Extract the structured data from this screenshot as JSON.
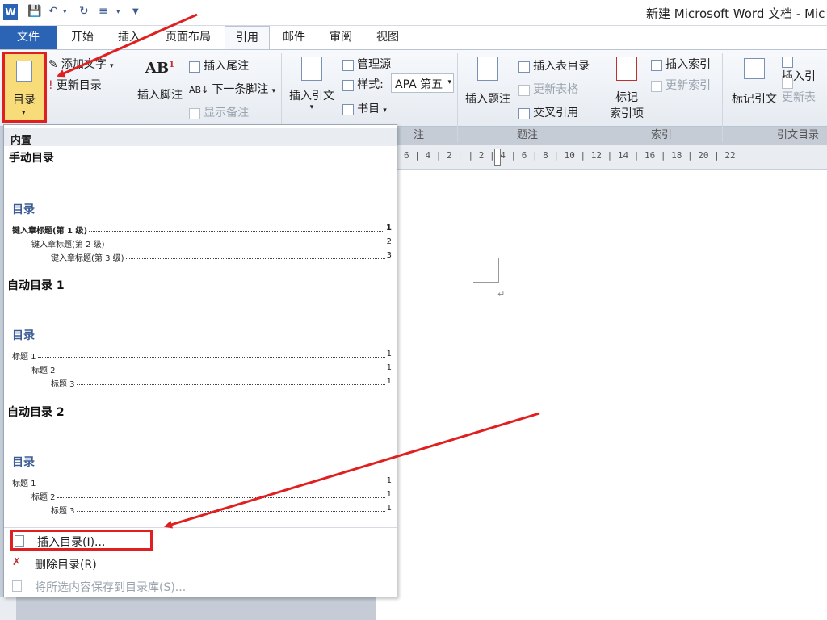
{
  "window": {
    "title": "新建 Microsoft Word 文档 - Mic"
  },
  "quick_access": {
    "icons": [
      "word-icon",
      "save-icon",
      "undo-icon",
      "redo-icon",
      "list-icon",
      "customize-icon"
    ]
  },
  "tabs": [
    {
      "label": "文件"
    },
    {
      "label": "开始"
    },
    {
      "label": "插入"
    },
    {
      "label": "页面布局"
    },
    {
      "label": "引用"
    },
    {
      "label": "邮件"
    },
    {
      "label": "审阅"
    },
    {
      "label": "视图"
    }
  ],
  "ribbon": {
    "toc": {
      "label": "目录",
      "add_text": "添加文字",
      "update_toc": "更新目录"
    },
    "footnote": {
      "insert_footnote": "插入脚注",
      "insert_endnote": "插入尾注",
      "next_footnote": "下一条脚注",
      "show_notes": "显示备注",
      "group_tail": "注"
    },
    "citation": {
      "insert_citation": "插入引文",
      "manage_sources": "管理源",
      "style_label": "样式:",
      "style_value": "APA 第五",
      "bibliography": "书目"
    },
    "caption": {
      "insert_caption": "插入题注",
      "insert_table_of_figures": "插入表目录",
      "update_table": "更新表格",
      "cross_reference": "交叉引用",
      "group": "题注"
    },
    "index": {
      "mark_entry_l1": "标记",
      "mark_entry_l2": "索引项",
      "insert_index": "插入索引",
      "update_index": "更新索引",
      "group": "索引"
    },
    "toa": {
      "mark_citation": "标记引文",
      "insert_toa": "插入引",
      "update_toa": "更新表",
      "group": "引文目录"
    }
  },
  "ruler": {
    "text": "6 | 4 | 2 |   | 2 | 4 | 6 | 8 | 10 | 12 | 14 | 16 | 18 | 20 | 22"
  },
  "dropdown": {
    "header": "内置",
    "galleries": [
      {
        "name": "手动目录",
        "toc_title": "目录",
        "lines": [
          {
            "text": "键入章标题(第 1 级)",
            "page": "1"
          },
          {
            "text": "键入章标题(第 2 级)",
            "page": "2"
          },
          {
            "text": "键入章标题(第 3 级)",
            "page": "3"
          }
        ]
      },
      {
        "name": "自动目录 1",
        "toc_title": "目录",
        "lines": [
          {
            "text": "标题 1",
            "page": "1"
          },
          {
            "text": "标题 2",
            "page": "1"
          },
          {
            "text": "标题 3",
            "page": "1"
          }
        ]
      },
      {
        "name": "自动目录 2",
        "toc_title": "目录",
        "lines": [
          {
            "text": "标题 1",
            "page": "1"
          },
          {
            "text": "标题 2",
            "page": "1"
          },
          {
            "text": "标题 3",
            "page": "1"
          }
        ]
      }
    ],
    "menu": {
      "insert_toc": "插入目录(I)...",
      "remove_toc": "删除目录(R)",
      "save_selection": "将所选内容保存到目录库(S)..."
    }
  },
  "document": {
    "paragraph_mark": "↵"
  },
  "colors": {
    "file_tab": "#2b63b5",
    "annotation_red": "#e02020",
    "toc_title": "#3b5d93"
  }
}
